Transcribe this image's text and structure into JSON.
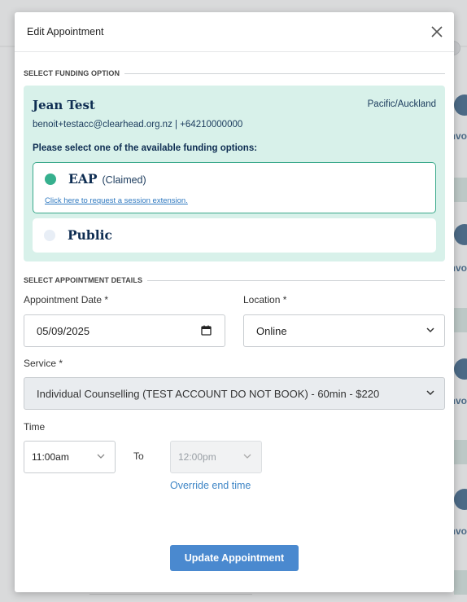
{
  "modal": {
    "title": "Edit Appointment",
    "close_icon": "close-icon"
  },
  "funding": {
    "section_title": "SELECT FUNDING OPTION",
    "client_name": "Jean Test",
    "timezone": "Pacific/Auckland",
    "contact": "benoit+testacc@clearhead.org.nz | +64210000000",
    "prompt": "Please select one of the available funding options:",
    "options": [
      {
        "label": "EAP",
        "status": "(Claimed)",
        "link": "Click here to request a session extension.",
        "selected": true
      },
      {
        "label": "Public",
        "selected": false
      }
    ]
  },
  "details": {
    "section_title": "SELECT APPOINTMENT DETAILS",
    "date_label": "Appointment Date *",
    "date_value": "05/09/2025",
    "location_label": "Location *",
    "location_value": "Online",
    "service_label": "Service *",
    "service_value": "Individual Counselling (TEST ACCOUNT DO NOT BOOK) - 60min - $220",
    "time_label": "Time",
    "start_time": "11:00am",
    "to_label": "To",
    "end_time": "12:00pm",
    "override_link": "Override end time"
  },
  "actions": {
    "update_label": "Update Appointment"
  },
  "background": {
    "partial_link": "nvo"
  },
  "colors": {
    "accent": "#4a89cf",
    "funding_bg": "#d8f1ea",
    "selected_border": "#3aa98b",
    "radio_on": "#36b08e",
    "heading_navy": "#0e2d52"
  }
}
